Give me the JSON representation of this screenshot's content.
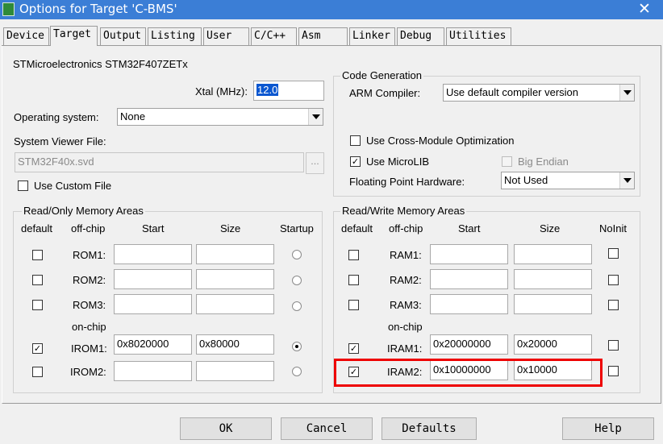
{
  "window": {
    "title": "Options for Target 'C-BMS'",
    "icon": "keil-icon",
    "close_glyph": "✕"
  },
  "tabs": [
    {
      "label": "Device"
    },
    {
      "label": "Target",
      "active": true
    },
    {
      "label": "Output"
    },
    {
      "label": "Listing"
    },
    {
      "label": "User"
    },
    {
      "label": "C/C++"
    },
    {
      "label": "Asm"
    },
    {
      "label": "Linker"
    },
    {
      "label": "Debug"
    },
    {
      "label": "Utilities"
    }
  ],
  "device_name": "STMicroelectronics STM32F407ZETx",
  "xtal": {
    "label": "Xtal (MHz):",
    "value": "12.0"
  },
  "os": {
    "label": "Operating system:",
    "value": "None"
  },
  "svd": {
    "label": "System Viewer File:",
    "value": "STM32F40x.svd",
    "browse": "..."
  },
  "custom_file": {
    "label": "Use Custom File",
    "checked": false
  },
  "codegen": {
    "title": "Code Generation",
    "compiler_label": "ARM Compiler:",
    "compiler_value": "Use default compiler version",
    "cross_module": {
      "label": "Use Cross-Module Optimization",
      "checked": false
    },
    "microlib": {
      "label": "Use MicroLIB",
      "checked": true
    },
    "big_endian": {
      "label": "Big Endian",
      "checked": false,
      "disabled": true
    },
    "fp_label": "Floating Point Hardware:",
    "fp_value": "Not Used"
  },
  "rom": {
    "title": "Read/Only Memory Areas",
    "headers": {
      "default": "default",
      "offchip": "off-chip",
      "start": "Start",
      "size": "Size",
      "startup": "Startup"
    },
    "onchip_label": "on-chip",
    "rows": [
      {
        "name": "ROM1:",
        "default": false,
        "start": "",
        "size": "",
        "startup": false
      },
      {
        "name": "ROM2:",
        "default": false,
        "start": "",
        "size": "",
        "startup": false
      },
      {
        "name": "ROM3:",
        "default": false,
        "start": "",
        "size": "",
        "startup": false
      },
      {
        "name": "IROM1:",
        "default": true,
        "start": "0x8020000",
        "size": "0x80000",
        "startup": true
      },
      {
        "name": "IROM2:",
        "default": false,
        "start": "",
        "size": "",
        "startup": false
      }
    ]
  },
  "ram": {
    "title": "Read/Write Memory Areas",
    "headers": {
      "default": "default",
      "offchip": "off-chip",
      "start": "Start",
      "size": "Size",
      "noinit": "NoInit"
    },
    "onchip_label": "on-chip",
    "rows": [
      {
        "name": "RAM1:",
        "default": false,
        "start": "",
        "size": "",
        "noinit": false
      },
      {
        "name": "RAM2:",
        "default": false,
        "start": "",
        "size": "",
        "noinit": false
      },
      {
        "name": "RAM3:",
        "default": false,
        "start": "",
        "size": "",
        "noinit": false
      },
      {
        "name": "IRAM1:",
        "default": true,
        "start": "0x20000000",
        "size": "0x20000",
        "noinit": false
      },
      {
        "name": "IRAM2:",
        "default": true,
        "start": "0x10000000",
        "size": "0x10000",
        "noinit": false
      }
    ]
  },
  "buttons": {
    "ok": "OK",
    "cancel": "Cancel",
    "defaults": "Defaults",
    "help": "Help"
  },
  "check_glyph": "✓",
  "colors": {
    "titlebar": "#3b7ed6",
    "highlight_box": "#e00000",
    "selection": "#0b57d0"
  }
}
